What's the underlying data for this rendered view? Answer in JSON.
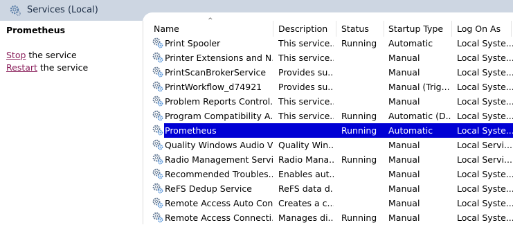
{
  "window": {
    "title": "Services (Local)"
  },
  "left_pane": {
    "service_name": "Prometheus",
    "actions": [
      {
        "link": "Stop",
        "rest": " the service"
      },
      {
        "link": "Restart",
        "rest": " the service"
      }
    ]
  },
  "table": {
    "columns": [
      "Name",
      "Description",
      "Status",
      "Startup Type",
      "Log On As"
    ],
    "sorted_column": "Name",
    "sort_indicator": "^",
    "selected_row": "Prometheus",
    "rows": [
      {
        "name": "Print Spooler",
        "description": "This service...",
        "status": "Running",
        "startup": "Automatic",
        "logon": "Local Syste..."
      },
      {
        "name": "Printer Extensions and N...",
        "description": "This service...",
        "status": "",
        "startup": "Manual",
        "logon": "Local Syste..."
      },
      {
        "name": "PrintScanBrokerService",
        "description": "Provides su...",
        "status": "",
        "startup": "Manual",
        "logon": "Local Syste..."
      },
      {
        "name": "PrintWorkflow_d74921",
        "description": "Provides su...",
        "status": "",
        "startup": "Manual (Trig...",
        "logon": "Local Syste..."
      },
      {
        "name": "Problem Reports Control...",
        "description": "This service...",
        "status": "",
        "startup": "Manual",
        "logon": "Local Syste..."
      },
      {
        "name": "Program Compatibility A...",
        "description": "This service...",
        "status": "Running",
        "startup": "Automatic (D...",
        "logon": "Local Syste..."
      },
      {
        "name": "Prometheus",
        "description": "",
        "status": "Running",
        "startup": "Automatic",
        "logon": "Local Syste..."
      },
      {
        "name": "Quality Windows Audio V...",
        "description": "Quality Win...",
        "status": "",
        "startup": "Manual",
        "logon": "Local Servi..."
      },
      {
        "name": "Radio Management Servi...",
        "description": "Radio Mana...",
        "status": "Running",
        "startup": "Manual",
        "logon": "Local Servi..."
      },
      {
        "name": "Recommended Troubles...",
        "description": "Enables aut...",
        "status": "",
        "startup": "Manual",
        "logon": "Local Syste..."
      },
      {
        "name": "ReFS Dedup Service",
        "description": "ReFS data d...",
        "status": "",
        "startup": "Manual",
        "logon": "Local Syste..."
      },
      {
        "name": "Remote Access Auto Con...",
        "description": "Creates a c...",
        "status": "",
        "startup": "Manual",
        "logon": "Local Syste..."
      },
      {
        "name": "Remote Access Connecti...",
        "description": "Manages di...",
        "status": "Running",
        "startup": "Manual",
        "logon": "Local Syste..."
      }
    ]
  },
  "colors": {
    "selection": "#0000d4",
    "titlebar": "#cdd6e2",
    "link": "#8a1f5b"
  },
  "icons": {
    "title": "services-gear-icon",
    "row": "service-gears-icon"
  }
}
